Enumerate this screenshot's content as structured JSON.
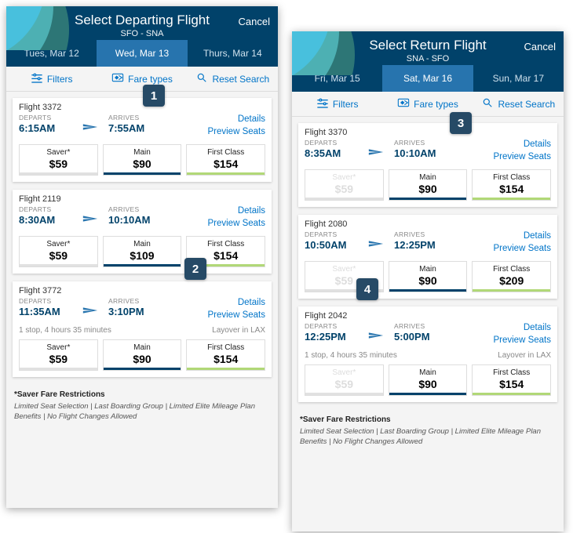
{
  "badges": [
    "1",
    "2",
    "3",
    "4"
  ],
  "screens": [
    {
      "key": "depart",
      "header": {
        "title": "Select Departing Flight",
        "subtitle": "SFO - SNA",
        "cancel": "Cancel"
      },
      "dates": [
        {
          "label": "Tues, Mar 12",
          "active": false
        },
        {
          "label": "Wed, Mar 13",
          "active": true
        },
        {
          "label": "Thurs, Mar 14",
          "active": false
        }
      ],
      "toolbar": {
        "filters": "Filters",
        "fare_types": "Fare types",
        "reset": "Reset Search"
      },
      "departs_label": "DEPARTS",
      "arrives_label": "ARRIVES",
      "details_label": "Details",
      "preview_label": "Preview Seats",
      "flights": [
        {
          "number": "Flight 3372",
          "depart": "6:15AM",
          "arrive": "7:55AM",
          "fares": [
            {
              "type": "saver",
              "label": "Saver*",
              "price": "$59",
              "disabled": false
            },
            {
              "type": "main",
              "label": "Main",
              "price": "$90",
              "disabled": false
            },
            {
              "type": "first",
              "label": "First Class",
              "price": "$154",
              "disabled": false
            }
          ]
        },
        {
          "number": "Flight 2119",
          "depart": "8:30AM",
          "arrive": "10:10AM",
          "fares": [
            {
              "type": "saver",
              "label": "Saver*",
              "price": "$59",
              "disabled": false
            },
            {
              "type": "main",
              "label": "Main",
              "price": "$109",
              "disabled": false
            },
            {
              "type": "first",
              "label": "First Class",
              "price": "$154",
              "disabled": false
            }
          ]
        },
        {
          "number": "Flight 3772",
          "depart": "11:35AM",
          "arrive": "3:10PM",
          "stop_text": "1 stop, 4 hours 35 minutes",
          "layover": "Layover in LAX",
          "fares": [
            {
              "type": "saver",
              "label": "Saver*",
              "price": "$59",
              "disabled": false
            },
            {
              "type": "main",
              "label": "Main",
              "price": "$90",
              "disabled": false
            },
            {
              "type": "first",
              "label": "First Class",
              "price": "$154",
              "disabled": false
            }
          ]
        }
      ],
      "footnote": {
        "heading": "*Saver Fare Restrictions",
        "body": "Limited Seat Selection | Last Boarding Group | Limited Elite Mileage Plan Benefits | No Flight Changes Allowed"
      }
    },
    {
      "key": "return",
      "header": {
        "title": "Select Return Flight",
        "subtitle": "SNA - SFO",
        "cancel": "Cancel"
      },
      "dates": [
        {
          "label": "Fri, Mar 15",
          "active": false
        },
        {
          "label": "Sat, Mar 16",
          "active": true
        },
        {
          "label": "Sun, Mar 17",
          "active": false
        }
      ],
      "toolbar": {
        "filters": "Filters",
        "fare_types": "Fare types",
        "reset": "Reset Search"
      },
      "departs_label": "DEPARTS",
      "arrives_label": "ARRIVES",
      "details_label": "Details",
      "preview_label": "Preview Seats",
      "flights": [
        {
          "number": "Flight 3370",
          "depart": "8:35AM",
          "arrive": "10:10AM",
          "fares": [
            {
              "type": "saver",
              "label": "Saver*",
              "price": "$59",
              "disabled": true
            },
            {
              "type": "main",
              "label": "Main",
              "price": "$90",
              "disabled": false
            },
            {
              "type": "first",
              "label": "First Class",
              "price": "$154",
              "disabled": false
            }
          ]
        },
        {
          "number": "Flight 2080",
          "depart": "10:50AM",
          "arrive": "12:25PM",
          "fares": [
            {
              "type": "saver",
              "label": "Saver*",
              "price": "$59",
              "disabled": true
            },
            {
              "type": "main",
              "label": "Main",
              "price": "$90",
              "disabled": false
            },
            {
              "type": "first",
              "label": "First Class",
              "price": "$209",
              "disabled": false
            }
          ]
        },
        {
          "number": "Flight 2042",
          "depart": "12:25PM",
          "arrive": "5:00PM",
          "stop_text": "1 stop, 4 hours 35 minutes",
          "layover": "Layover in LAX",
          "fares": [
            {
              "type": "saver",
              "label": "Saver*",
              "price": "$59",
              "disabled": true
            },
            {
              "type": "main",
              "label": "Main",
              "price": "$90",
              "disabled": false
            },
            {
              "type": "first",
              "label": "First Class",
              "price": "$154",
              "disabled": false
            }
          ]
        }
      ],
      "footnote": {
        "heading": "*Saver Fare Restrictions",
        "body": "Limited Seat Selection | Last Boarding Group | Limited Elite Mileage Plan Benefits | No Flight Changes Allowed"
      }
    }
  ]
}
